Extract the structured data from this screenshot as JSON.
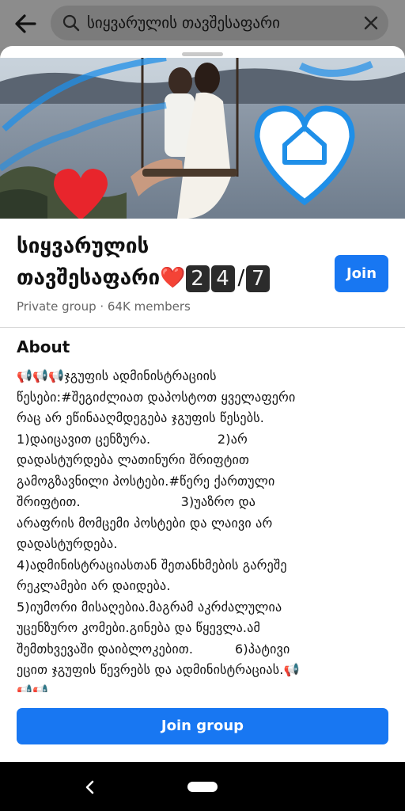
{
  "search": {
    "query": "სიყვარულის თავშესაფარი"
  },
  "group": {
    "name_line1": "სიყვარულის",
    "name_line2": "თავშესაფარი",
    "heart_emoji": "❤️",
    "badge_digits": [
      "2",
      "4",
      "7"
    ],
    "slash": "/",
    "join_label": "Join",
    "meta": "Private group · 64K members"
  },
  "about": {
    "title": "About",
    "body": "📢📢📢ჯგუფის ადმინისტრაციის\nწესები:#შეგიძლიათ დაპოსტოთ ყველაფერი\nრაც არ ეწინააღმდეგება ჯგუფის წესებს.\n1)დაიცავით ცენზურა.                2)არ\nდადასტურდება ლათინური შრიფტით\nგამოგზავნილი პოსტები.#წერე ქართული\nშრიფტით.                        3)უაზრო და\nარაფრის მომცემი პოსტები და ლაივი არ\nდადასტურდება.\n4)ადმინისტრაციასთან შეთანხმების გარეშე\nრეკლამები არ დაიდება.\n5)იუმორი მისაღებია.მაგრამ აკრძალულია\nუცენზურო კომები.გინება და წყევლა.ამ\nშემთხვევაში დაიბლოკებით.          6)პატივი\nეცით ჯგუფის წევრებს და ადმინისტრაციას.📢\n📢📢"
  },
  "actions": {
    "join_group_label": "Join group"
  },
  "colors": {
    "accent": "#1877f2",
    "scrim": "#8a8a8a"
  },
  "icons": {
    "top_back": "back-arrow-icon",
    "search": "search-icon",
    "clear": "clear-icon",
    "nav_back": "nav-back-icon"
  }
}
